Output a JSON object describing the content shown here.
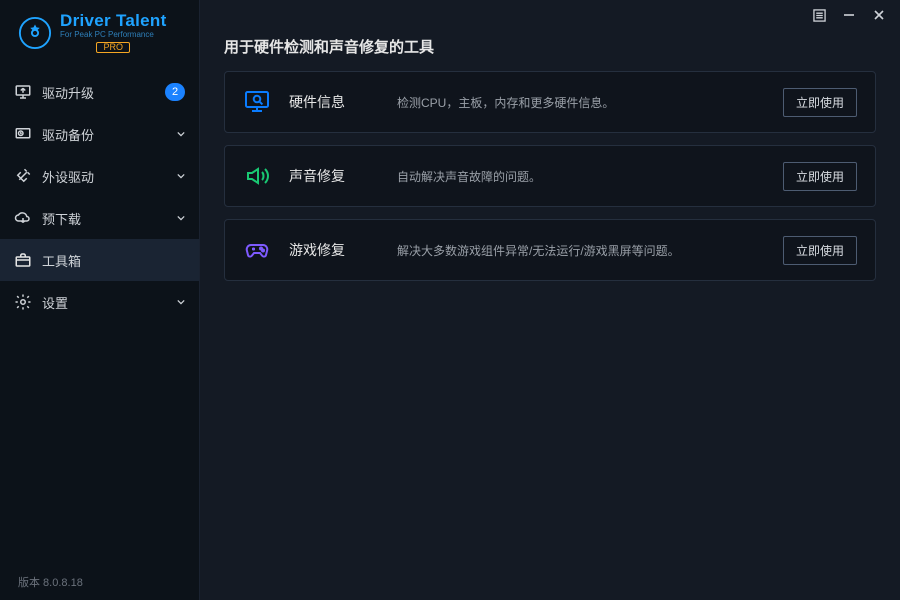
{
  "app": {
    "title": "Driver Talent",
    "subtitle": "For Peak PC Performance",
    "edition": "PRO"
  },
  "sidebar": {
    "items": [
      {
        "label": "驱动升级",
        "icon": "monitor-up-icon",
        "badge": "2"
      },
      {
        "label": "驱动备份",
        "icon": "clock-back-icon",
        "expandable": true
      },
      {
        "label": "外设驱动",
        "icon": "plug-icon",
        "expandable": true
      },
      {
        "label": "预下载",
        "icon": "cloud-down-icon",
        "expandable": true
      },
      {
        "label": "工具箱",
        "icon": "toolbox-icon",
        "active": true
      },
      {
        "label": "设置",
        "icon": "gear-icon",
        "expandable": true
      }
    ]
  },
  "version": {
    "label": "版本 8.0.8.18"
  },
  "page": {
    "title": "用于硬件检测和声音修复的工具",
    "tools": [
      {
        "icon": "#0a7cff",
        "name": "硬件信息",
        "desc": "检测CPU，主板，内存和更多硬件信息。",
        "action": "立即使用"
      },
      {
        "icon": "#19c973",
        "name": "声音修复",
        "desc": "自动解决声音故障的问题。",
        "action": "立即使用"
      },
      {
        "icon": "#7e5aff",
        "name": "游戏修复",
        "desc": "解决大多数游戏组件异常/无法运行/游戏黑屏等问题。",
        "action": "立即使用"
      }
    ]
  }
}
